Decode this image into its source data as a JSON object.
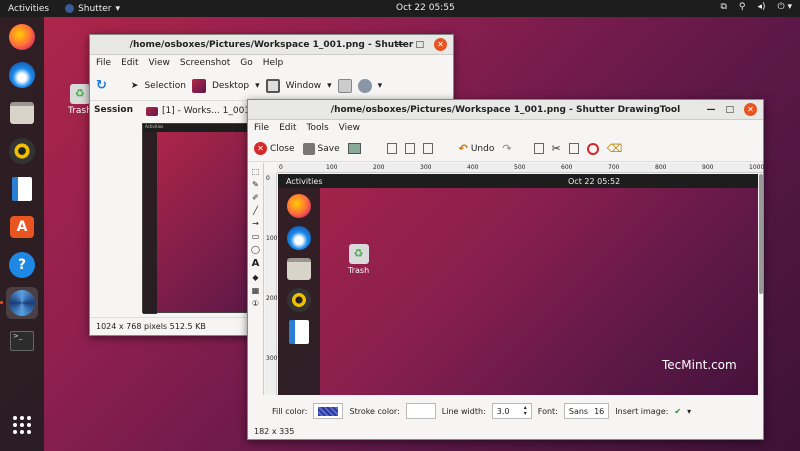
{
  "topbar": {
    "activities": "Activities",
    "app": "Shutter",
    "app_arrow": "▾",
    "clock": "Oct 22  05:55",
    "tray": [
      "⧉",
      "⚲",
      "◂)",
      "⏻ ▾"
    ]
  },
  "desktop": {
    "trash_label": "Trash"
  },
  "shutter": {
    "title": "/home/osboxes/Pictures/Workspace 1_001.png - Shutter",
    "menu": [
      "File",
      "Edit",
      "View",
      "Screenshot",
      "Go",
      "Help"
    ],
    "toolbar": {
      "selection": "Selection",
      "desktop": "Desktop",
      "window": "Window",
      "dropdown_arrow": "▾"
    },
    "session": "Session",
    "tab_label": "[1] - Works... 1_001.png",
    "status": "1024 x 768 pixels  512.5 KB"
  },
  "draw": {
    "title": "/home/osboxes/Pictures/Workspace 1_001.png - Shutter DrawingTool",
    "menu": [
      "File",
      "Edit",
      "Tools",
      "View"
    ],
    "toolbar": {
      "close": "Close",
      "save": "Save",
      "undo": "Undo"
    },
    "ruler_ticks": [
      "0",
      "100",
      "200",
      "300",
      "400",
      "500",
      "600",
      "700",
      "800",
      "900",
      "1000"
    ],
    "vruler_ticks": [
      "0",
      "100",
      "200",
      "300"
    ],
    "shot": {
      "activities": "Activities",
      "clock": "Oct 22  05:52",
      "trash": "Trash",
      "watermark": "TecMint.com"
    },
    "props": {
      "fill_label": "Fill color:",
      "stroke_label": "Stroke color:",
      "line_width_label": "Line width:",
      "line_width_value": "3.0",
      "font_label": "Font:",
      "font_value": "Sans",
      "font_size": "16",
      "insert_image_label": "Insert image:"
    },
    "status": "182 x 335"
  },
  "colors": {
    "accent": "#e95420",
    "topbar": "#1d1d1d"
  }
}
